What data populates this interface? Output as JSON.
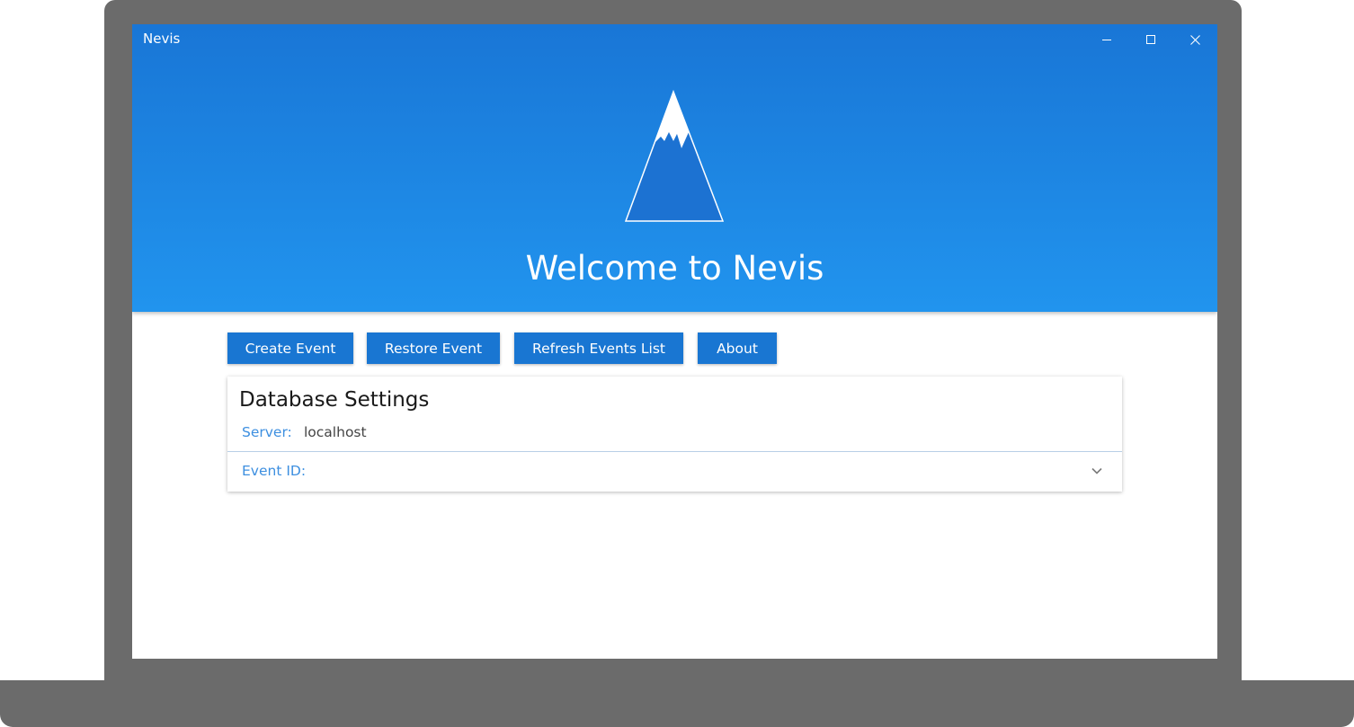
{
  "window": {
    "title": "Nevis",
    "controls": {
      "minimize": "minimize-icon",
      "maximize": "maximize-icon",
      "close": "close-icon"
    }
  },
  "hero": {
    "logo": "mountain-logo-icon",
    "title": "Welcome to Nevis"
  },
  "toolbar": {
    "create_label": "Create Event",
    "restore_label": "Restore Event",
    "refresh_label": "Refresh Events List",
    "about_label": "About"
  },
  "database_settings": {
    "title": "Database Settings",
    "server_label": "Server:",
    "server_value": "localhost",
    "event_id_label": "Event ID:",
    "event_id_icon": "chevron-down-icon"
  },
  "colors": {
    "accent": "#1976d2",
    "hero_top": "#1976d6",
    "hero_bottom": "#2194ee",
    "label": "#3d8fe0",
    "device": "#6b6b6b"
  }
}
